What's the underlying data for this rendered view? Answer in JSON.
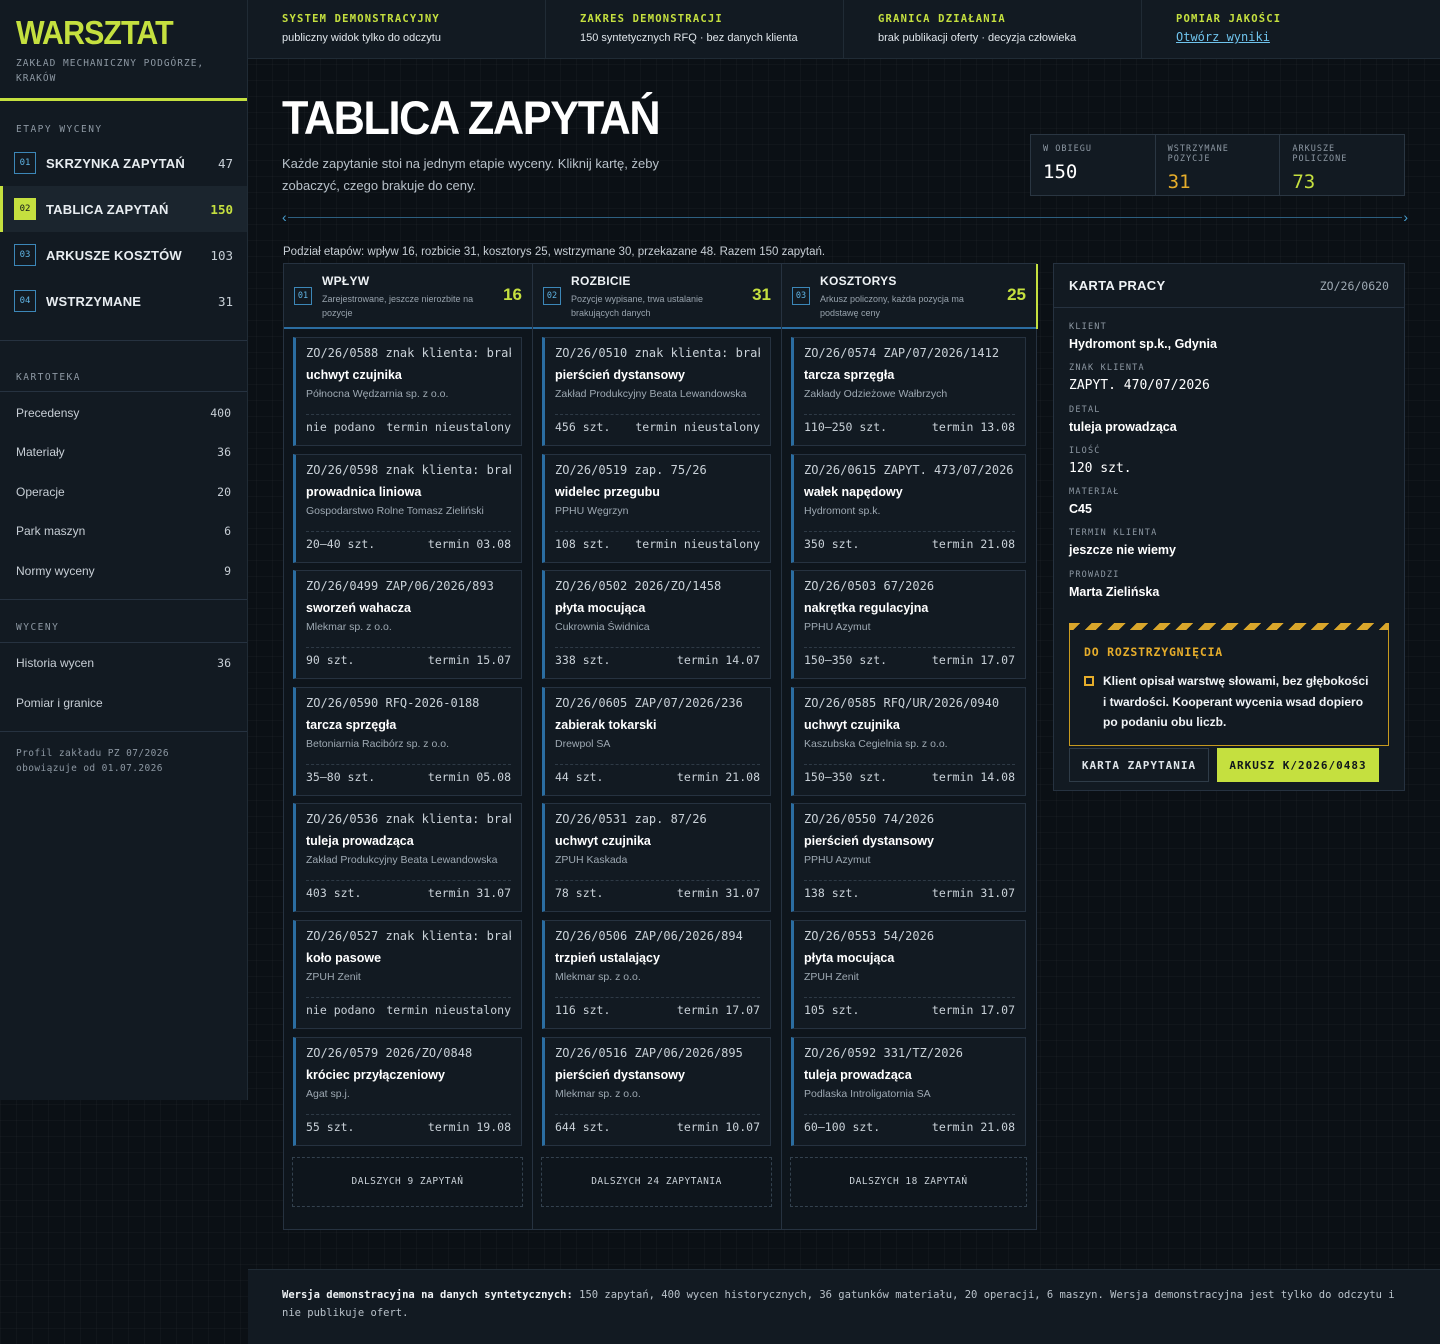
{
  "brand": {
    "logo": "WARSZTAT",
    "subtitle": "ZAKŁAD MECHANICZNY PODGÓRZE, KRAKÓW"
  },
  "sidebar": {
    "stages_label": "ETAPY WYCENY",
    "stages": [
      {
        "num": "01",
        "label": "SKRZYNKA ZAPYTAŃ",
        "count": "47"
      },
      {
        "num": "02",
        "label": "TABLICA ZAPYTAŃ",
        "count": "150"
      },
      {
        "num": "03",
        "label": "ARKUSZE KOSZTÓW",
        "count": "103"
      },
      {
        "num": "04",
        "label": "WSTRZYMANE",
        "count": "31"
      }
    ],
    "kartoteka_label": "KARTOTEKA",
    "kartoteka": [
      {
        "label": "Precedensy",
        "count": "400"
      },
      {
        "label": "Materiały",
        "count": "36"
      },
      {
        "label": "Operacje",
        "count": "20"
      },
      {
        "label": "Park maszyn",
        "count": "6"
      },
      {
        "label": "Normy wyceny",
        "count": "9"
      }
    ],
    "wyceny_label": "WYCENY",
    "wyceny": [
      {
        "label": "Historia wycen",
        "count": "36"
      },
      {
        "label": "Pomiar i granice",
        "count": ""
      }
    ],
    "footer_line1": "Profil zakładu PZ 07/2026",
    "footer_line2": "obowiązuje od 01.07.2026"
  },
  "topbar": [
    {
      "title": "SYSTEM DEMONSTRACYJNY",
      "text": "publiczny widok tylko do odczytu"
    },
    {
      "title": "ZAKRES DEMONSTRACJI",
      "text": "150 syntetycznych RFQ · bez danych klienta"
    },
    {
      "title": "GRANICA DZIAŁANIA",
      "text": "brak publikacji oferty · decyzja człowieka"
    },
    {
      "title": "POMIAR JAKOŚCI",
      "link": "Otwórz wyniki"
    }
  ],
  "main": {
    "title": "TABLICA ZAPYTAŃ",
    "description": "Każde zapytanie stoi na jednym etapie wyceny. Kliknij kartę, żeby zobaczyć, czego brakuje do ceny.",
    "summary": "Podział etapów: wpływ 16, rozbicie 31, kosztorys 25, wstrzymane 30, przekazane 48. Razem 150 zapytań.",
    "nav_prev": "‹",
    "nav_next": "›"
  },
  "stats": [
    {
      "label": "W OBIEGU",
      "value": "150",
      "color": "#ffffff"
    },
    {
      "label": "WSTRZYMANE POZYCJE",
      "value": "31",
      "color": "#e6ad2b"
    },
    {
      "label": "ARKUSZE POLICZONE",
      "value": "73",
      "color": "#c5e03f"
    }
  ],
  "columns": [
    {
      "num": "01",
      "title": "WPŁYW",
      "subtitle": "Zarejestrowane, jeszcze nierozbite na pozycje",
      "count": "16",
      "more": "DALSZYCH 9 ZAPYTAŃ",
      "cards": [
        {
          "id": "ZO/26/0588 znak klienta: brak",
          "part": "uchwyt czujnika",
          "client": "Północna Wędzarnia sp. z o.o.",
          "qty": "nie podano",
          "due": "termin nieustalony"
        },
        {
          "id": "ZO/26/0598 znak klienta: brak",
          "part": "prowadnica liniowa",
          "client": "Gospodarstwo Rolne Tomasz Zieliński",
          "qty": "20–40 szt.",
          "due": "termin 03.08"
        },
        {
          "id": "ZO/26/0499 ZAP/06/2026/893",
          "part": "sworzeń wahacza",
          "client": "Mlekmar sp. z o.o.",
          "qty": "90 szt.",
          "due": "termin 15.07"
        },
        {
          "id": "ZO/26/0590 RFQ-2026-0188",
          "part": "tarcza sprzęgła",
          "client": "Betoniarnia Racibórz sp. z o.o.",
          "qty": "35–80 szt.",
          "due": "termin 05.08"
        },
        {
          "id": "ZO/26/0536 znak klienta: brak",
          "part": "tuleja prowadząca",
          "client": "Zakład Produkcyjny Beata Lewandowska",
          "qty": "403 szt.",
          "due": "termin 31.07"
        },
        {
          "id": "ZO/26/0527 znak klienta: brak",
          "part": "koło pasowe",
          "client": "ZPUH Zenit",
          "qty": "nie podano",
          "due": "termin nieustalony"
        },
        {
          "id": "ZO/26/0579 2026/ZO/0848",
          "part": "króciec przyłączeniowy",
          "client": "Agat sp.j.",
          "qty": "55 szt.",
          "due": "termin 19.08"
        }
      ]
    },
    {
      "num": "02",
      "title": "ROZBICIE",
      "subtitle": "Pozycje wypisane, trwa ustalanie brakujących danych",
      "count": "31",
      "more": "DALSZYCH 24 ZAPYTANIA",
      "cards": [
        {
          "id": "ZO/26/0510 znak klienta: brak",
          "part": "pierścień dystansowy",
          "client": "Zakład Produkcyjny Beata Lewandowska",
          "qty": "456 szt.",
          "due": "termin nieustalony"
        },
        {
          "id": "ZO/26/0519 zap. 75/26",
          "part": "widelec przegubu",
          "client": "PPHU Węgrzyn",
          "qty": "108 szt.",
          "due": "termin nieustalony"
        },
        {
          "id": "ZO/26/0502 2026/ZO/1458",
          "part": "płyta mocująca",
          "client": "Cukrownia Świdnica",
          "qty": "338 szt.",
          "due": "termin 14.07"
        },
        {
          "id": "ZO/26/0605 ZAP/07/2026/236",
          "part": "zabierak tokarski",
          "client": "Drewpol SA",
          "qty": "44 szt.",
          "due": "termin 21.08"
        },
        {
          "id": "ZO/26/0531 zap. 87/26",
          "part": "uchwyt czujnika",
          "client": "ZPUH Kaskada",
          "qty": "78 szt.",
          "due": "termin 31.07"
        },
        {
          "id": "ZO/26/0506 ZAP/06/2026/894",
          "part": "trzpień ustalający",
          "client": "Mlekmar sp. z o.o.",
          "qty": "116 szt.",
          "due": "termin 17.07"
        },
        {
          "id": "ZO/26/0516 ZAP/06/2026/895",
          "part": "pierścień dystansowy",
          "client": "Mlekmar sp. z o.o.",
          "qty": "644 szt.",
          "due": "termin 10.07"
        }
      ]
    },
    {
      "num": "03",
      "title": "KOSZTORYS",
      "subtitle": "Arkusz policzony, każda pozycja ma podstawę ceny",
      "count": "25",
      "more": "DALSZYCH 18 ZAPYTAŃ",
      "cards": [
        {
          "id": "ZO/26/0574 ZAP/07/2026/1412",
          "part": "tarcza sprzęgła",
          "client": "Zakłady Odzieżowe Wałbrzych",
          "qty": "110–250 szt.",
          "due": "termin 13.08"
        },
        {
          "id": "ZO/26/0615 ZAPYT. 473/07/2026",
          "part": "wałek napędowy",
          "client": "Hydromont sp.k.",
          "qty": "350 szt.",
          "due": "termin 21.08"
        },
        {
          "id": "ZO/26/0503 67/2026",
          "part": "nakrętka regulacyjna",
          "client": "PPHU Azymut",
          "qty": "150–350 szt.",
          "due": "termin 17.07"
        },
        {
          "id": "ZO/26/0585 RFQ/UR/2026/0940",
          "part": "uchwyt czujnika",
          "client": "Kaszubska Cegielnia sp. z o.o.",
          "qty": "150–350 szt.",
          "due": "termin 14.08"
        },
        {
          "id": "ZO/26/0550 74/2026",
          "part": "pierścień dystansowy",
          "client": "PPHU Azymut",
          "qty": "138 szt.",
          "due": "termin 31.07"
        },
        {
          "id": "ZO/26/0553 54/2026",
          "part": "płyta mocująca",
          "client": "ZPUH Zenit",
          "qty": "105 szt.",
          "due": "termin 17.07"
        },
        {
          "id": "ZO/26/0592 331/TZ/2026",
          "part": "tuleja prowadząca",
          "client": "Podlaska Introligatornia SA",
          "qty": "60–100 szt.",
          "due": "termin 21.08"
        }
      ]
    }
  ],
  "jobcard": {
    "title": "KARTA PRACY",
    "id": "ZO/26/0620",
    "fields": [
      {
        "label": "KLIENT",
        "value": "Hydromont sp.k., Gdynia",
        "mono": false
      },
      {
        "label": "ZNAK KLIENTA",
        "value": "ZAPYT. 470/07/2026",
        "mono": true
      },
      {
        "label": "DETAL",
        "value": "tuleja prowadząca",
        "mono": false
      },
      {
        "label": "ILOŚĆ",
        "value": "120 szt.",
        "mono": true
      },
      {
        "label": "MATERIAŁ",
        "value": "C45",
        "mono": false
      },
      {
        "label": "TERMIN KLIENTA",
        "value": "jeszcze nie wiemy",
        "mono": false
      },
      {
        "label": "PROWADZI",
        "value": "Marta Zielińska",
        "mono": false
      }
    ],
    "warning_title": "DO ROZSTRZYGNIĘCIA",
    "warning_text": "Klient opisał warstwę słowami, bez głębokości i twardości. Kooperant wycenia wsad dopiero po podaniu obu liczb.",
    "btn_secondary": "KARTA ZAPYTANIA",
    "btn_primary": "ARKUSZ K/2026/0483"
  },
  "footer": {
    "lead": "Wersja demonstracyjna na danych syntetycznych:",
    "text": "150 zapytań, 400 wycen historycznych, 36 gatunków materiału, 20 operacji, 6 maszyn. Wersja demonstracyjna jest tylko do odczytu i nie publikuje ofert."
  },
  "colors": {
    "accent": "#c5e03f",
    "warning": "#e6ad2b",
    "link": "#6fc3ec",
    "column_rule": "#2b6da1"
  }
}
